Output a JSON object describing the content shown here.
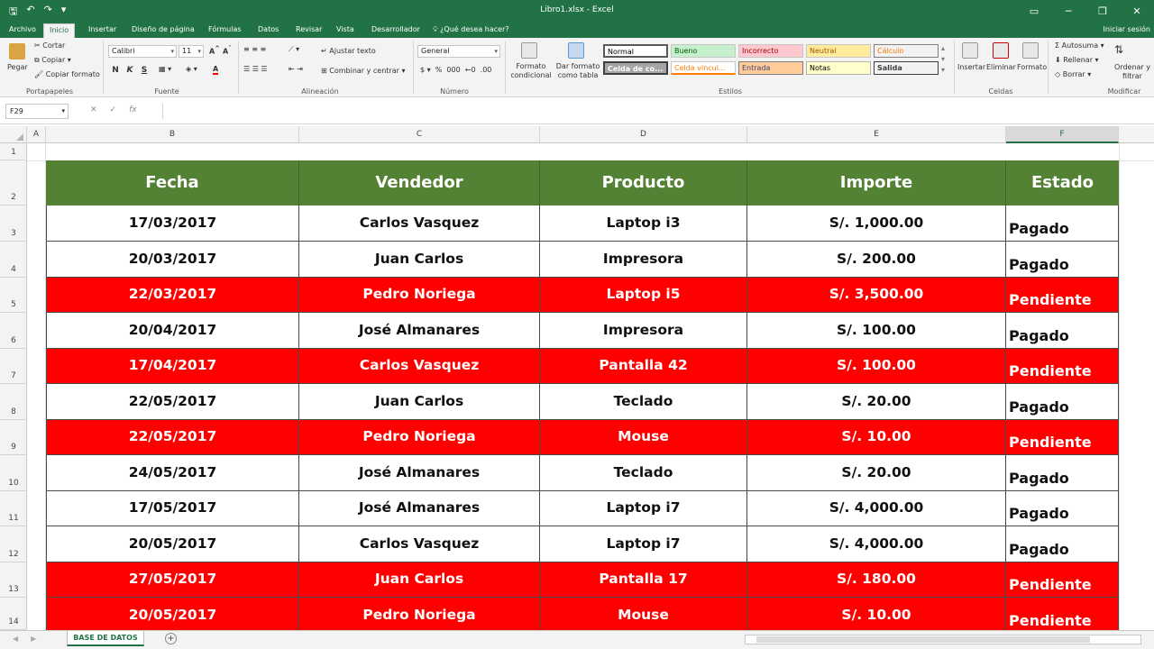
{
  "titlebar": {
    "doc_title": "Libro1.xlsx - Excel",
    "qat_save": "🖫",
    "qat_undo": "↶",
    "qat_redo": "↷",
    "qat_more": "▾"
  },
  "tabs": {
    "items": [
      "Archivo",
      "Inicio",
      "Insertar",
      "Diseño de página",
      "Fórmulas",
      "Datos",
      "Revisar",
      "Vista",
      "Desarrollador"
    ],
    "tell_me": "¿Qué desea hacer?",
    "sign_in": "Iniciar sesión"
  },
  "ribbon": {
    "clipboard": {
      "paste": "Pegar",
      "cut": "Cortar",
      "copy": "Copiar",
      "format_painter": "Copiar formato",
      "label": "Portapapeles"
    },
    "font": {
      "name": "Calibri",
      "size": "11",
      "bold": "N",
      "italic": "K",
      "underline": "S",
      "label": "Fuente"
    },
    "alignment": {
      "wrap": "Ajustar texto",
      "merge": "Combinar y centrar",
      "label": "Alineación"
    },
    "number": {
      "format": "General",
      "label": "Número"
    },
    "styles": {
      "conditional": "Formato condicional",
      "format_table": "Dar formato como tabla",
      "label": "Estilos",
      "items": [
        {
          "name": "Normal",
          "bg": "#ffffff",
          "fg": "#000000"
        },
        {
          "name": "Bueno",
          "bg": "#c6efce",
          "fg": "#006100"
        },
        {
          "name": "Incorrecto",
          "bg": "#ffc7ce",
          "fg": "#9c0006"
        },
        {
          "name": "Neutral",
          "bg": "#ffeb9c",
          "fg": "#9c5700"
        },
        {
          "name": "Cálculo",
          "bg": "#f2f2f2",
          "fg": "#fa7d00"
        },
        {
          "name": "Celda de co...",
          "bg": "#a5a5a5",
          "fg": "#ffffff"
        },
        {
          "name": "Celda vincul...",
          "bg": "#ffffff",
          "fg": "#fa7d00"
        },
        {
          "name": "Entrada",
          "bg": "#ffcc99",
          "fg": "#3f3f76"
        },
        {
          "name": "Notas",
          "bg": "#ffffcc",
          "fg": "#000000"
        },
        {
          "name": "Salida",
          "bg": "#f2f2f2",
          "fg": "#3f3f3f"
        }
      ]
    },
    "cells": {
      "insert": "Insertar",
      "delete": "Eliminar",
      "format": "Formato",
      "label": "Celdas"
    },
    "editing": {
      "autosum": "Autosuma",
      "fill": "Rellenar",
      "clear": "Borrar",
      "sort": "Ordenar y filtrar",
      "label": "Modificar"
    }
  },
  "formula_bar": {
    "name_box": "F29",
    "cancel": "✕",
    "enter": "✓",
    "fx": "fx",
    "value": ""
  },
  "columns": [
    "A",
    "B",
    "C",
    "D",
    "E",
    "F"
  ],
  "selected_column": "F",
  "rows": [
    "1",
    "2",
    "3",
    "4",
    "5",
    "6",
    "7",
    "8",
    "9",
    "10",
    "11",
    "12",
    "13",
    "14"
  ],
  "table": {
    "headers": [
      "Fecha",
      "Vendedor",
      "Producto",
      "Importe",
      "Estado"
    ],
    "header_color": "#548235",
    "pending_color": "#ff0000",
    "records": [
      {
        "fecha": "17/03/2017",
        "vendedor": "Carlos Vasquez",
        "producto": "Laptop i3",
        "importe": "S/. 1,000.00",
        "estado": "Pagado"
      },
      {
        "fecha": "20/03/2017",
        "vendedor": "Juan Carlos",
        "producto": "Impresora",
        "importe": "S/. 200.00",
        "estado": "Pagado"
      },
      {
        "fecha": "22/03/2017",
        "vendedor": "Pedro Noriega",
        "producto": "Laptop i5",
        "importe": "S/. 3,500.00",
        "estado": "Pendiente"
      },
      {
        "fecha": "20/04/2017",
        "vendedor": "José Almanares",
        "producto": "Impresora",
        "importe": "S/. 100.00",
        "estado": "Pagado"
      },
      {
        "fecha": "17/04/2017",
        "vendedor": "Carlos Vasquez",
        "producto": "Pantalla 42",
        "importe": "S/. 100.00",
        "estado": "Pendiente"
      },
      {
        "fecha": "22/05/2017",
        "vendedor": "Juan Carlos",
        "producto": "Teclado",
        "importe": "S/. 20.00",
        "estado": "Pagado"
      },
      {
        "fecha": "22/05/2017",
        "vendedor": "Pedro Noriega",
        "producto": "Mouse",
        "importe": "S/. 10.00",
        "estado": "Pendiente"
      },
      {
        "fecha": "24/05/2017",
        "vendedor": "José Almanares",
        "producto": "Teclado",
        "importe": "S/. 20.00",
        "estado": "Pagado"
      },
      {
        "fecha": "17/05/2017",
        "vendedor": "José Almanares",
        "producto": "Laptop i7",
        "importe": "S/. 4,000.00",
        "estado": "Pagado"
      },
      {
        "fecha": "20/05/2017",
        "vendedor": "Carlos Vasquez",
        "producto": "Laptop i7",
        "importe": "S/. 4,000.00",
        "estado": "Pagado"
      },
      {
        "fecha": "27/05/2017",
        "vendedor": "Juan Carlos",
        "producto": "Pantalla 17",
        "importe": "S/. 180.00",
        "estado": "Pendiente"
      },
      {
        "fecha": "20/05/2017",
        "vendedor": "Pedro Noriega",
        "producto": "Mouse",
        "importe": "S/. 10.00",
        "estado": "Pendiente"
      }
    ]
  },
  "sheets": {
    "active": "BASE DE DATOS",
    "add": "+"
  }
}
